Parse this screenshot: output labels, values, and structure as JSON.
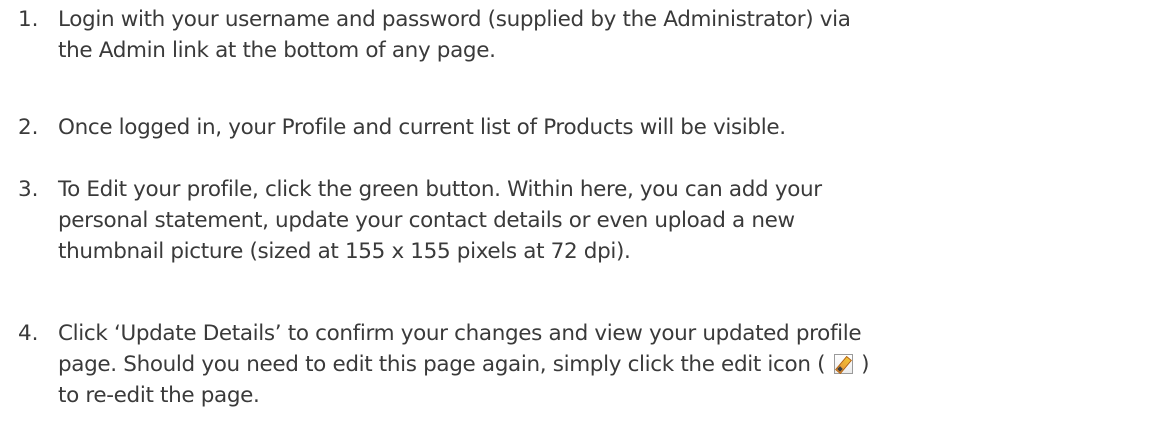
{
  "instructions": {
    "steps": [
      {
        "number": "1.",
        "lines": [
          "Login with your username and password (supplied by the Administrator) via",
          "the Admin link at the bottom of any page."
        ]
      },
      {
        "number": "2.",
        "lines": [
          "Once logged in, your Profile and current list of Products will be visible."
        ]
      },
      {
        "number": "3.",
        "lines": [
          "To Edit your profile, click the green button. Within here, you can add your",
          "personal statement, update your contact details or even upload a new",
          "thumbnail picture (sized at 155 x 155 pixels at 72 dpi)."
        ]
      },
      {
        "number": "4.",
        "lines": [
          "Click ‘Update Details’ to confirm your changes and view your updated profile"
        ],
        "line_with_icon": {
          "before": "page. Should you need to edit this page again, simply click the edit icon (",
          "icon": "edit-icon",
          "after": ")"
        },
        "last_line": "to re-edit the page."
      }
    ]
  }
}
